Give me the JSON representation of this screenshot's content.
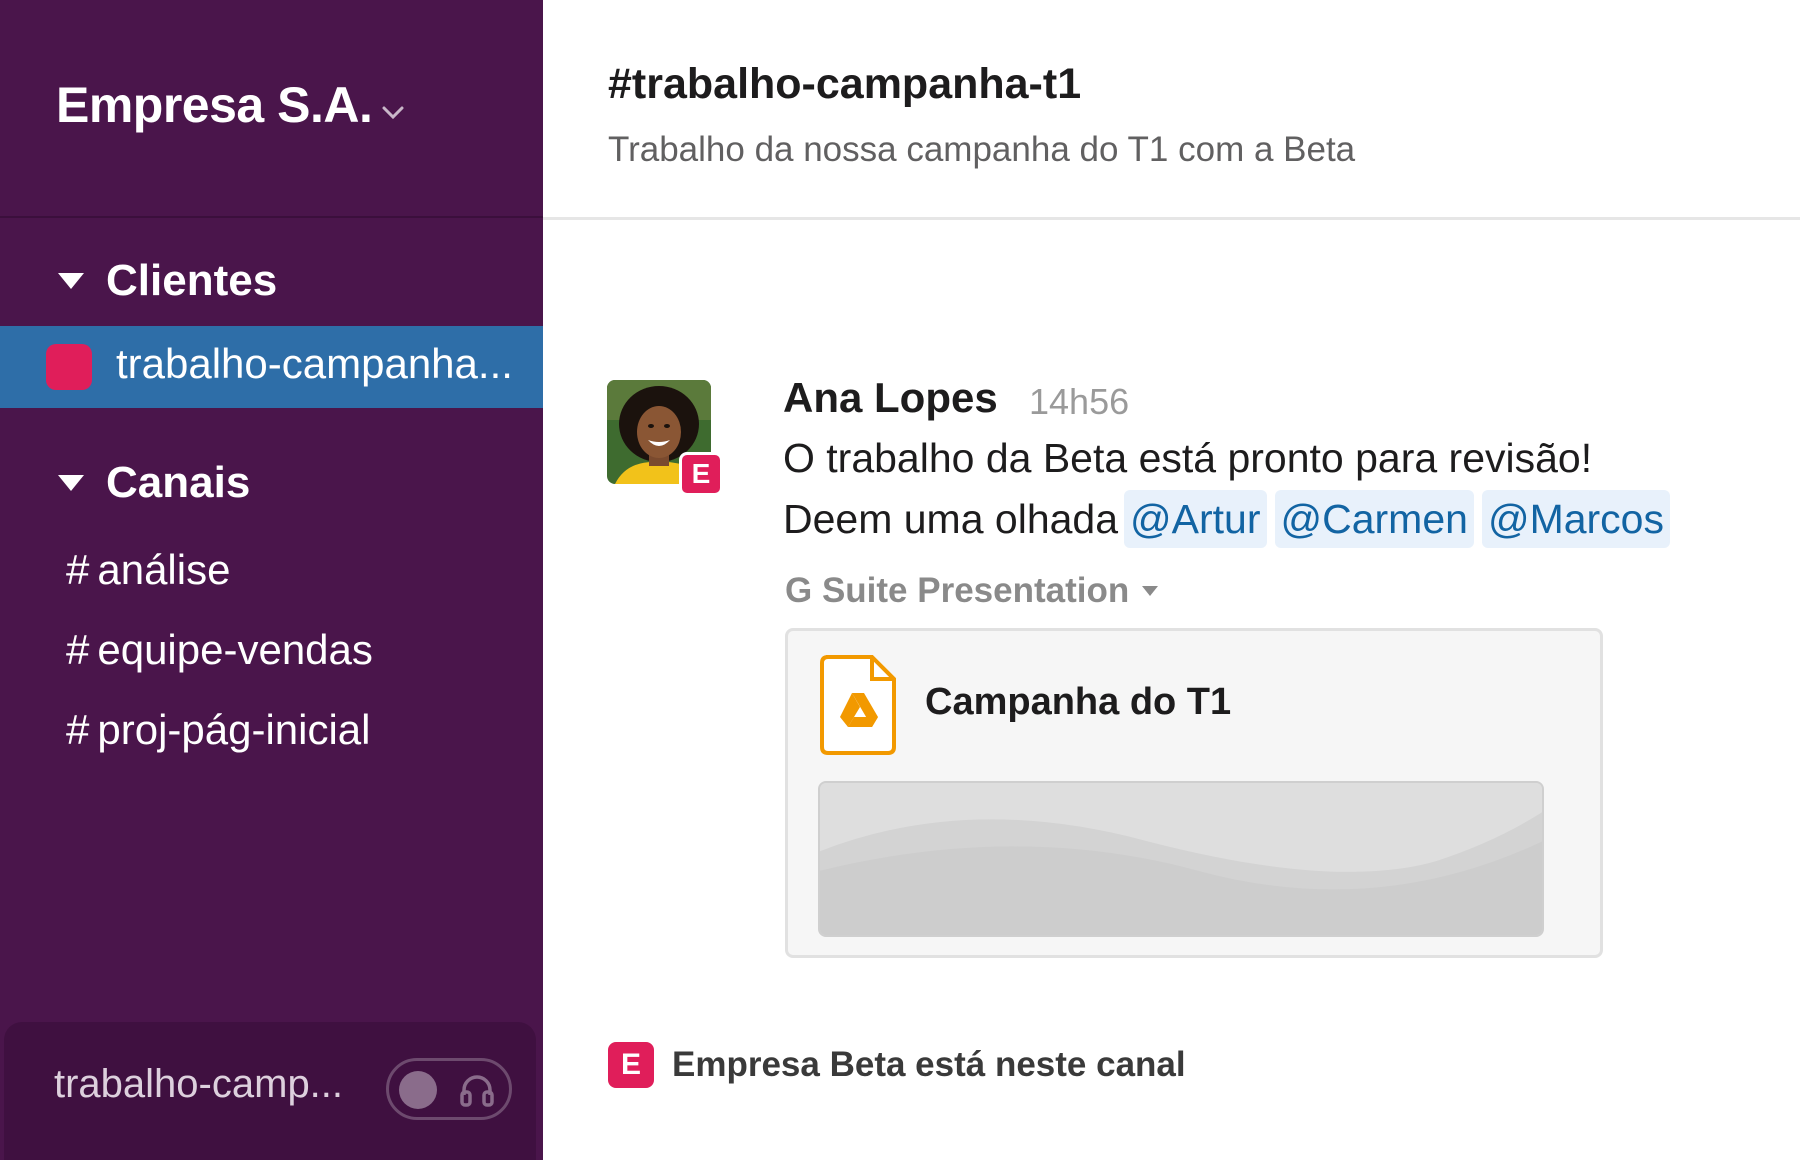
{
  "workspace": {
    "name": "Empresa S.A."
  },
  "sidebar": {
    "section_clients": "Clientes",
    "active_channel": "trabalho-campanha...",
    "section_channels": "Canais",
    "channels": [
      {
        "hash": "#",
        "name": "análise"
      },
      {
        "hash": "#",
        "name": "equipe-vendas"
      },
      {
        "hash": "#",
        "name": "proj-pág-inicial"
      }
    ],
    "bottom_label": "trabalho-camp..."
  },
  "header": {
    "title": "#trabalho-campanha-t1",
    "topic": "Trabalho da nossa campanha do T1 com a Beta"
  },
  "message": {
    "author": "Ana Lopes",
    "timestamp": "14h56",
    "badge": "E",
    "line1": "O trabalho da Beta está pronto para revisão!",
    "line2_prefix": "Deem uma olhada",
    "mentions": [
      "@Artur",
      "@Carmen",
      "@Marcos"
    ],
    "attachment_type": "G Suite Presentation",
    "file_title": "Campanha do T1"
  },
  "notice": {
    "badge": "E",
    "text": "Empresa Beta está neste canal"
  },
  "colors": {
    "sidebar_bg": "#4a154b",
    "active_bg": "#2e6ea8",
    "external_accent": "#e01e5a",
    "mention_text": "#1264a3",
    "slides_orange": "#f29900"
  },
  "icons": [
    "chevron-down-icon",
    "triangle-down-icon",
    "headphones-icon",
    "google-drive-icon",
    "caret-down-icon"
  ]
}
